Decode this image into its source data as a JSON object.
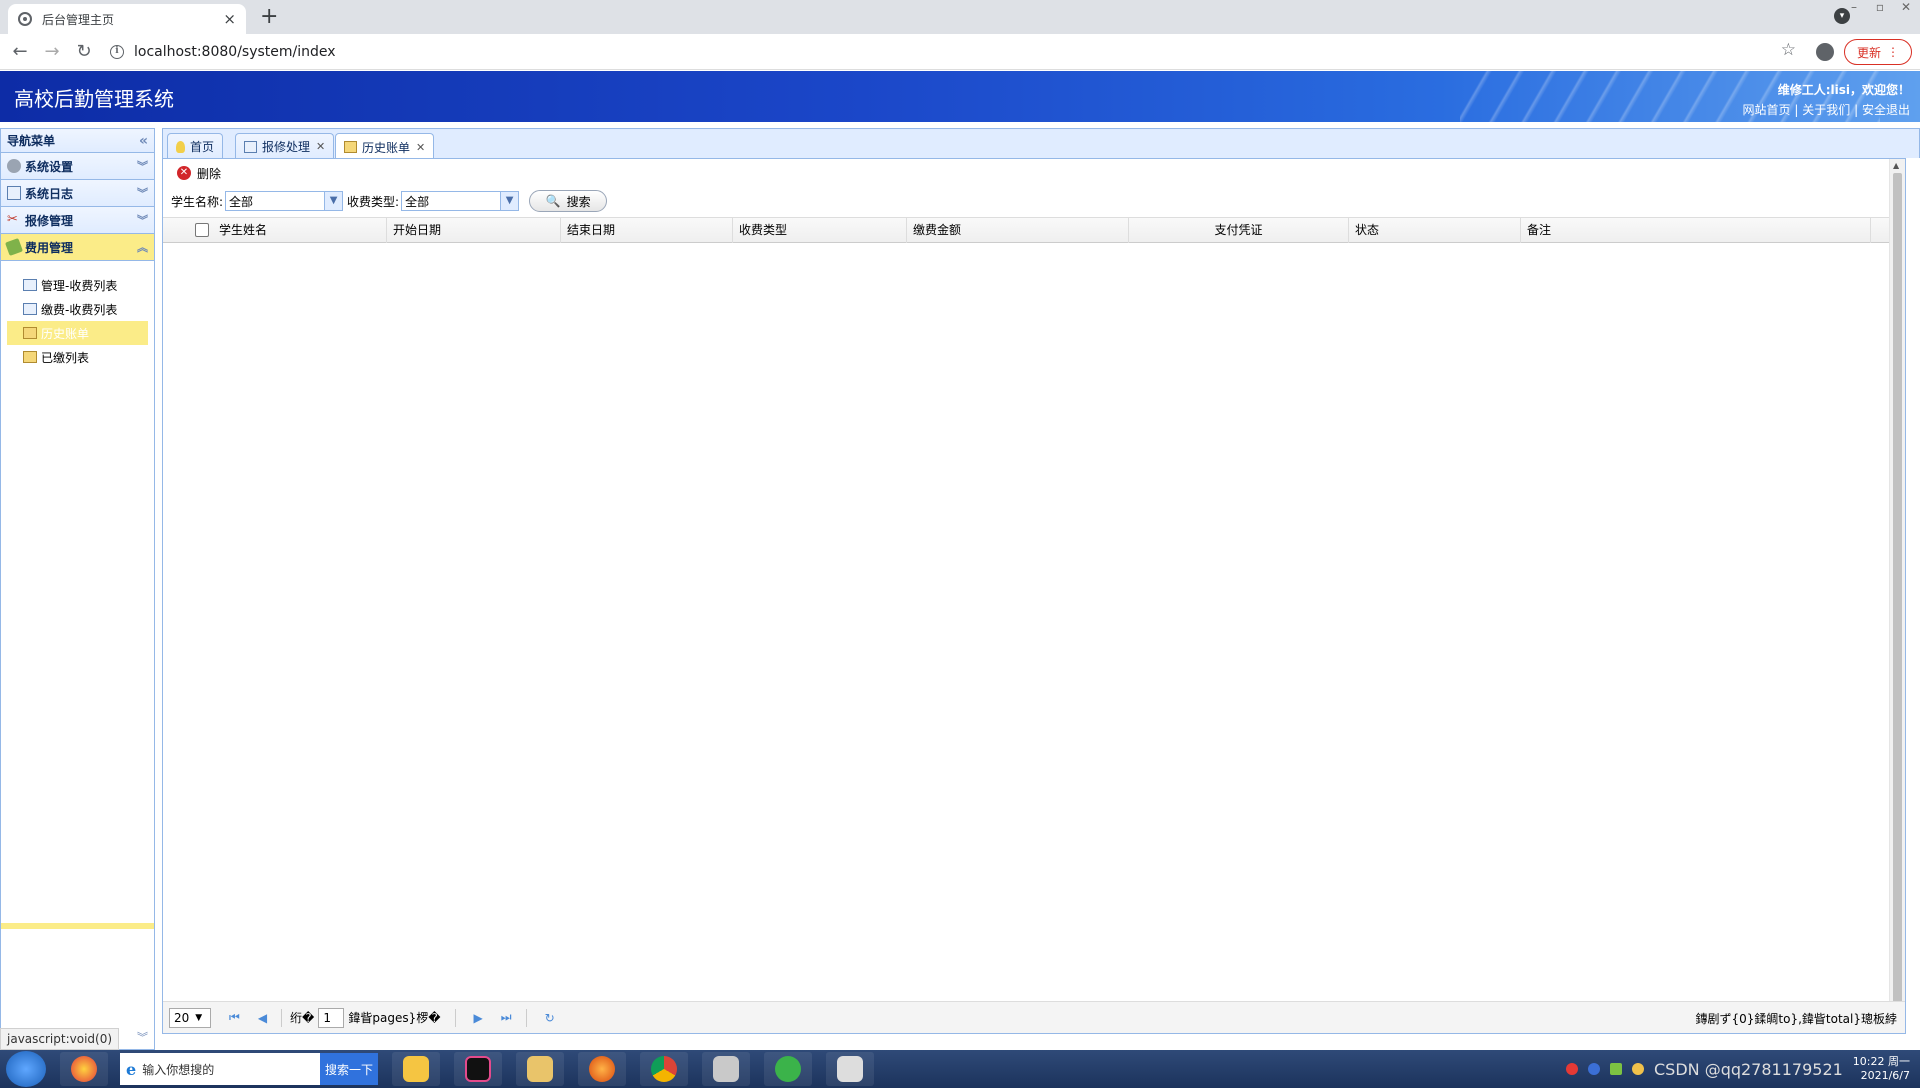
{
  "browser": {
    "tab_title": "后台管理主页",
    "tab_close": "×",
    "new_tab": "+",
    "url": "localhost:8080/system/index",
    "update_label": "更新"
  },
  "header": {
    "title": "高校后勤管理系统",
    "welcome": "维修工人:lisi，欢迎您！",
    "links": [
      "网站首页",
      "关于我们",
      "安全退出"
    ],
    "link_sep": "|"
  },
  "sidebar": {
    "title": "导航菜单",
    "sections": [
      {
        "label": "系统设置"
      },
      {
        "label": "系统日志"
      },
      {
        "label": "报修管理"
      },
      {
        "label": "费用管理"
      }
    ],
    "items": [
      {
        "label": "管理-收费列表"
      },
      {
        "label": "缴费-收费列表"
      },
      {
        "label": "历史账单"
      },
      {
        "label": "已缴列表"
      }
    ],
    "footer_status": "javascript:void(0)"
  },
  "tabs": [
    {
      "label": "首页",
      "closable": false
    },
    {
      "label": "报修处理",
      "closable": true
    },
    {
      "label": "历史账单",
      "closable": true
    }
  ],
  "toolbar": {
    "delete_label": "删除"
  },
  "search": {
    "student_label": "学生名称:",
    "student_value": "全部",
    "type_label": "收费类型:",
    "type_value": "全部",
    "button_label": "搜索"
  },
  "grid": {
    "columns": [
      "学生姓名",
      "开始日期",
      "结束日期",
      "收费类型",
      "缴费金额",
      "支付凭证",
      "状态",
      "备注"
    ],
    "rows": []
  },
  "pager": {
    "page_size": "20",
    "page_prefix": "绗�",
    "page_value": "1",
    "page_suffix": "鍏眥pages}椤�",
    "info": "鏄剧ず{0}鍒皗to},鍏眥total}璁板綍"
  },
  "taskbar": {
    "search_placeholder": "输入你想搜的",
    "search_button": "搜索一下",
    "clock_time": "10:22 周一",
    "clock_date": "2021/6/7",
    "watermark": "CSDN @qq2781179521"
  },
  "colors": {
    "header_blue": "#1b47c9",
    "panel_border": "#95b8e7",
    "selected_yellow": "#fbec88",
    "delete_red": "#d2262a"
  }
}
